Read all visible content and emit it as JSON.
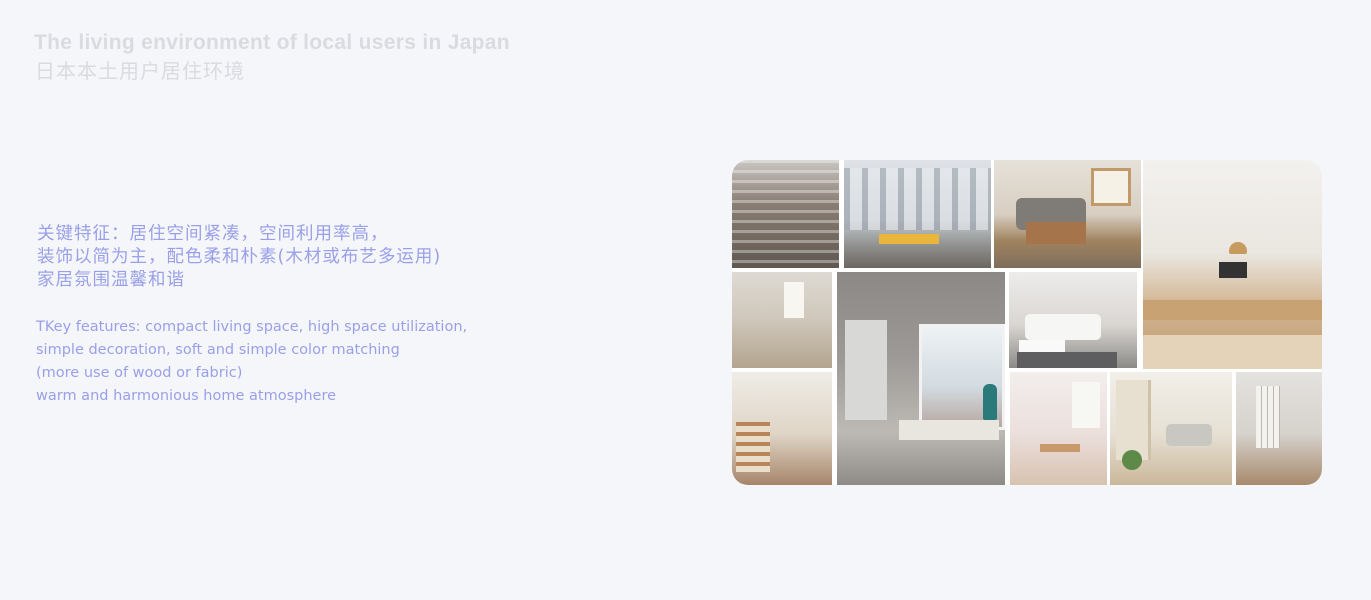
{
  "header": {
    "title_en": "The living environment of local users in Japan",
    "title_cn": "日本本土用户居住环境"
  },
  "features_cn": {
    "line1": "关键特征：居住空间紧凑，空间利用率高，",
    "line2": "装饰以简为主，配色柔和朴素(木材或布艺多运用)",
    "line3": "家居氛围温馨和谐"
  },
  "features_en": {
    "line1": "TKey features: compact living space, high space utilization,",
    "line2": "simple decoration, soft and simple color matching",
    "line3": "(more use of wood or fabric)",
    "line4": "warm and harmonious home atmosphere"
  },
  "colors": {
    "background": "#f5f6fa",
    "title": "#d9dbe0",
    "accent_text": "#9aa0e8"
  },
  "collage": {
    "photos": [
      "apartment-building-exterior-photo",
      "apartment-facade-street-photo",
      "living-room-sofa-photo",
      "wooden-dining-room-photo",
      "small-kitchen-photo",
      "window-seat-photo",
      "white-sofa-living-room-photo",
      "staircase-interior-photo",
      "dining-nook-photo",
      "bright-living-room-photo",
      "shoji-hallway-photo"
    ]
  }
}
